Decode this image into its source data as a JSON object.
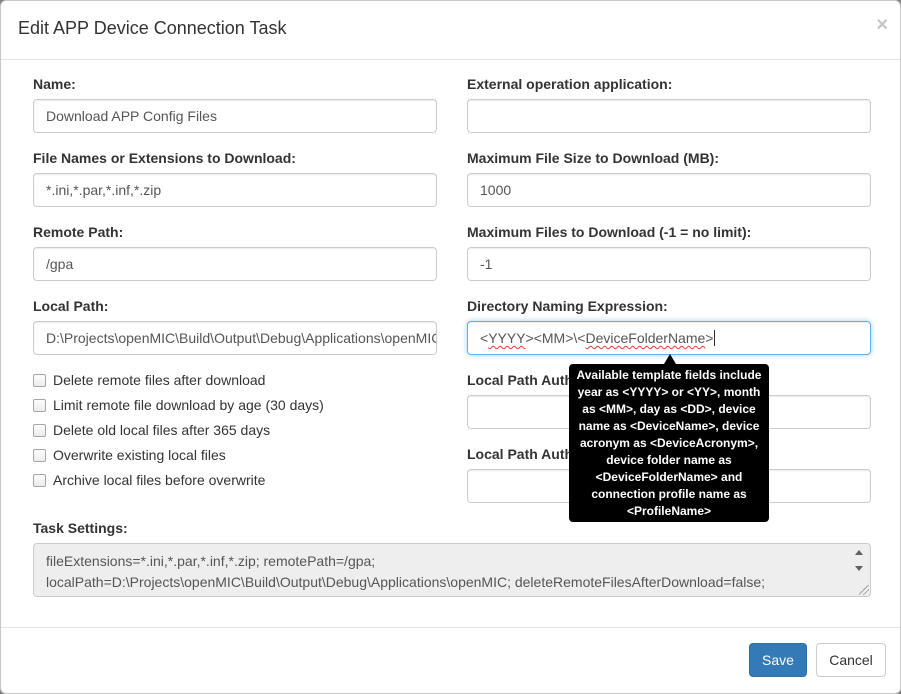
{
  "dialog": {
    "title": "Edit APP Device Connection Task",
    "close_glyph": "×"
  },
  "fields": {
    "name": {
      "label": "Name:",
      "value": "Download APP Config Files"
    },
    "file_names": {
      "label": "File Names or Extensions to Download:",
      "value": "*.ini,*.par,*.inf,*.zip"
    },
    "remote_path": {
      "label": "Remote Path:",
      "value": "/gpa"
    },
    "local_path": {
      "label": "Local Path:",
      "value": "D:\\Projects\\openMIC\\Build\\Output\\Debug\\Applications\\openMIC"
    },
    "external_app": {
      "label": "External operation application:",
      "value": ""
    },
    "max_file_size": {
      "label": "Maximum File Size to Download (MB):",
      "value": "1000"
    },
    "max_files": {
      "label": "Maximum Files to Download (-1 = no limit):",
      "value": "-1"
    },
    "directory_naming": {
      "label": "Directory Naming Expression:",
      "value_parts": [
        "<",
        "YYYY",
        "><MM>\\<",
        "DeviceFolderName",
        ">"
      ]
    },
    "local_path_auth_user": {
      "label": "Local Path Authentication User:",
      "value": ""
    },
    "local_path_auth_password": {
      "label": "Local Path Authentication Password:",
      "value": ""
    }
  },
  "checkboxes": [
    {
      "label": "Delete remote files after download",
      "checked": false
    },
    {
      "label": "Limit remote file download by age (30 days)",
      "checked": false
    },
    {
      "label": "Delete old local files after 365 days",
      "checked": false
    },
    {
      "label": "Overwrite existing local files",
      "checked": false
    },
    {
      "label": "Archive local files before overwrite",
      "checked": false
    }
  ],
  "tooltip": {
    "lines": [
      "Available template fields include",
      "year as <YYYY> or <YY>, month",
      "as <MM>, day as <DD>, device",
      "name as <DeviceName>, device",
      "acronym as <DeviceAcronym>,",
      "device folder name as",
      "<DeviceFolderName> and",
      "connection profile name as",
      "<ProfileName>"
    ]
  },
  "task_settings": {
    "label": "Task Settings:",
    "lines": [
      "fileExtensions=*.ini,*.par,*.inf,*.zip; remotePath=/gpa;",
      "localPath=D:\\Projects\\openMIC\\Build\\Output\\Debug\\Applications\\openMIC; deleteRemoteFilesAfterDownload=false;"
    ]
  },
  "buttons": {
    "save": "Save",
    "cancel": "Cancel"
  },
  "colors": {
    "primary": "#337ab7",
    "focus_border": "#66afe9",
    "tooltip_bg": "#000000"
  }
}
